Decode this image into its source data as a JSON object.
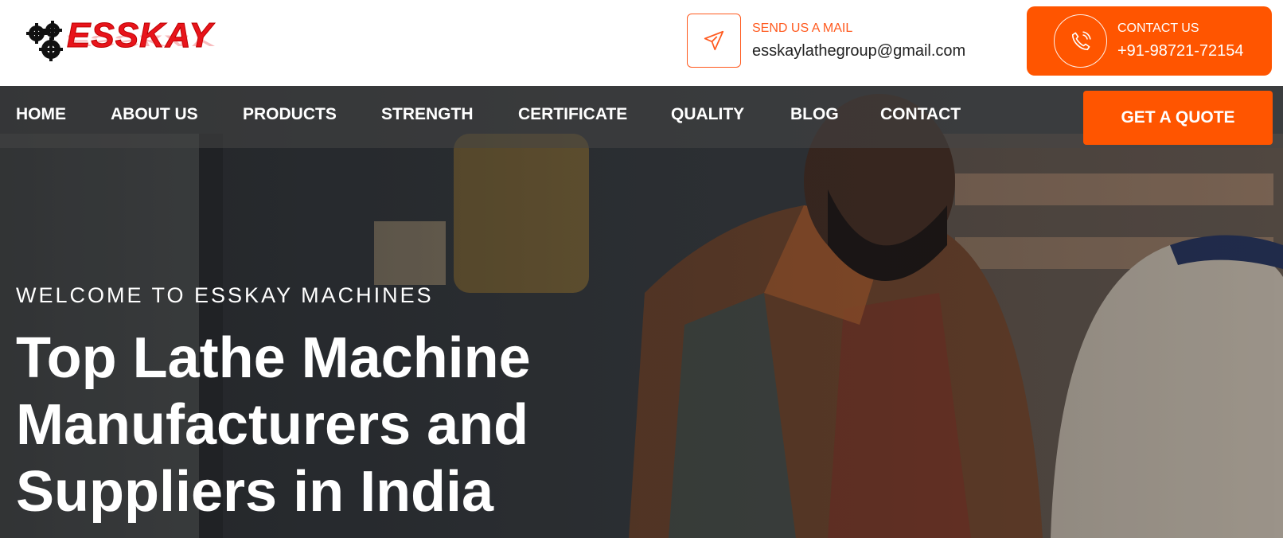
{
  "logo": {
    "text": "ESSKAY",
    "icon": "gears-icon"
  },
  "mail": {
    "label": "SEND US A MAIL",
    "value": "esskaylathegroup@gmail.com",
    "icon": "paper-plane-icon"
  },
  "contact": {
    "label": "CONTACT US",
    "value": "+91-98721-72154",
    "icon": "phone-icon"
  },
  "nav": {
    "items": [
      "HOME",
      "ABOUT US",
      "PRODUCTS",
      "STRENGTH",
      "CERTIFICATE",
      "QUALITY",
      "BLOG",
      "CONTACT"
    ],
    "quote_button": "GET A QUOTE"
  },
  "hero": {
    "welcome": "WELCOME TO ESSKAY MACHINES",
    "headline_lines": [
      "Top Lathe Machine",
      "Manufacturers and",
      "Suppliers in India"
    ]
  },
  "colors": {
    "accent": "#ff5500",
    "logo_red": "#e8141b",
    "text_dark": "#222222"
  }
}
